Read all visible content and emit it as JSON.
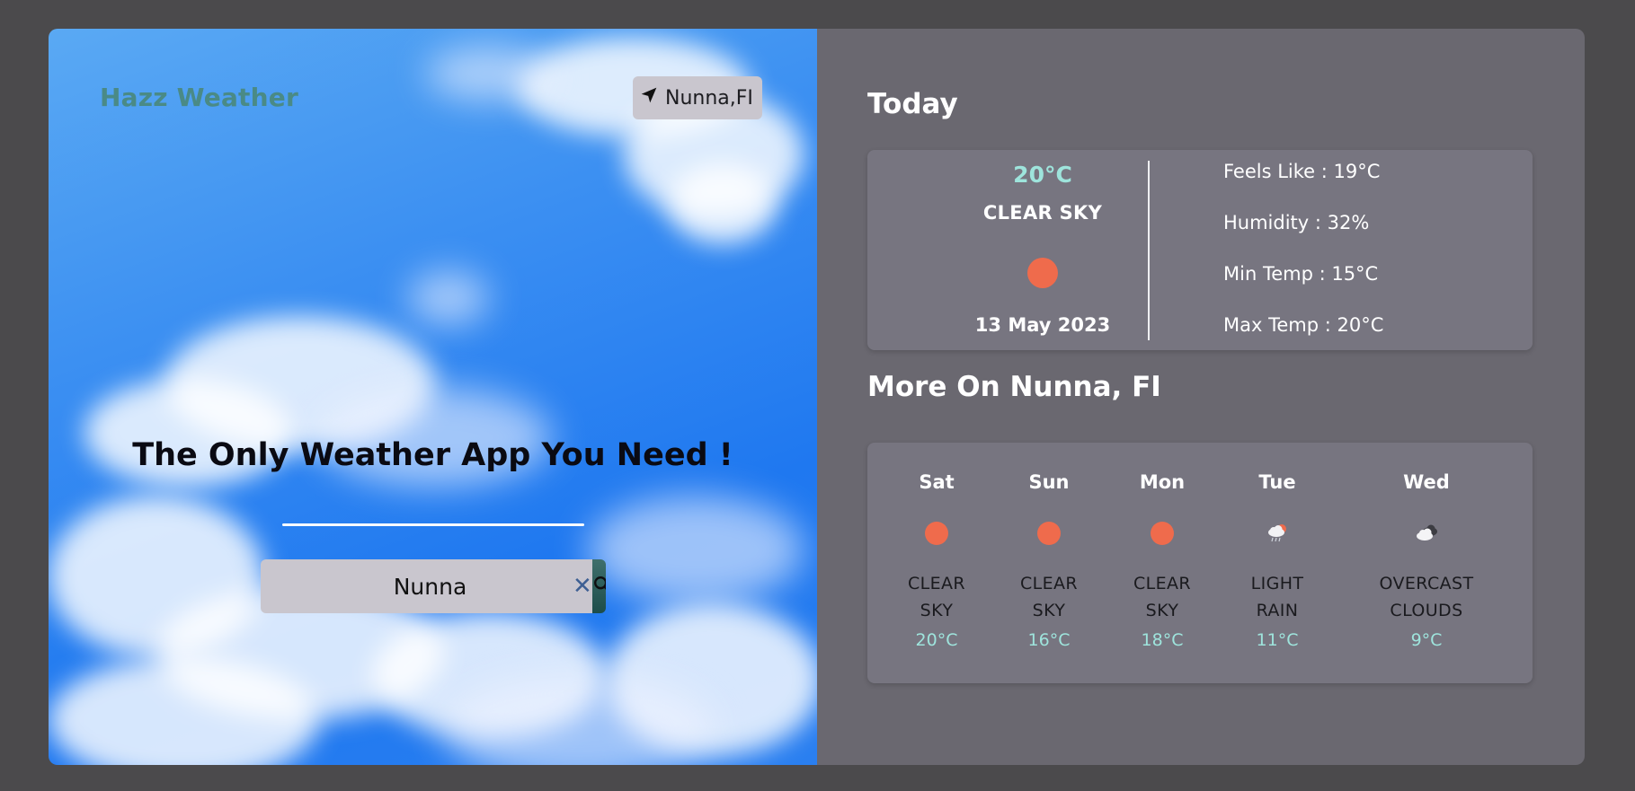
{
  "brand": {
    "name": "Hazz Weather"
  },
  "location_button": {
    "label": "Nunna,FI",
    "icon": "navigation-arrow-icon"
  },
  "hero": {
    "tagline": "The Only Weather App You Need !"
  },
  "search": {
    "value": "Nunna",
    "clear_icon": "close-icon",
    "search_icon": "search-icon"
  },
  "today": {
    "title": "Today",
    "temp": "20°C",
    "description": "CLEAR SKY",
    "icon": "sun-icon",
    "date": "13 May 2023",
    "feels_like": "Feels Like : 19°C",
    "humidity": "Humidity : 32%",
    "min_temp": "Min Temp : 15°C",
    "max_temp": "Max Temp : 20°C"
  },
  "forecast": {
    "title": "More On Nunna, FI",
    "days": [
      {
        "name": "Sat",
        "desc_line1": "CLEAR",
        "desc_line2": "SKY",
        "temp": "20°C",
        "icon": "sun-icon"
      },
      {
        "name": "Sun",
        "desc_line1": "CLEAR",
        "desc_line2": "SKY",
        "temp": "16°C",
        "icon": "sun-icon"
      },
      {
        "name": "Mon",
        "desc_line1": "CLEAR",
        "desc_line2": "SKY",
        "temp": "18°C",
        "icon": "sun-icon"
      },
      {
        "name": "Tue",
        "desc_line1": "LIGHT",
        "desc_line2": "RAIN",
        "temp": "11°C",
        "icon": "rain-cloud-icon"
      },
      {
        "name": "Wed",
        "desc_line1": "OVERCAST",
        "desc_line2": "CLOUDS",
        "temp": "9°C",
        "icon": "overcast-clouds-icon"
      }
    ]
  },
  "colors": {
    "accent_temp": "#9ee4dc",
    "sun": "#ef6b4c",
    "brand": "#4a8a86",
    "panel": "#6a6870",
    "card": "#777580"
  }
}
